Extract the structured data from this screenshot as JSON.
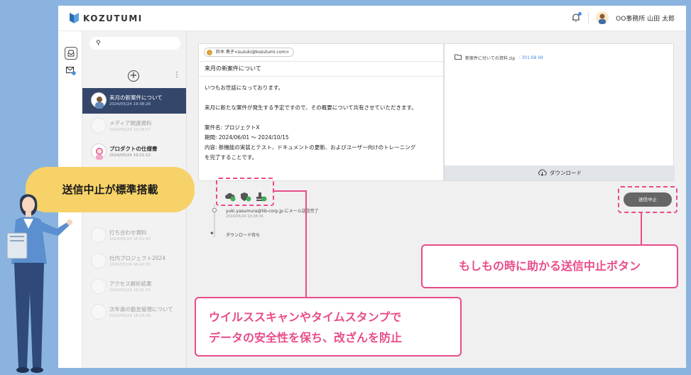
{
  "app": {
    "logo_text": "KOZUTUMI"
  },
  "header": {
    "user_name": "OO事務所 山田 太郎"
  },
  "list": {
    "items": [
      {
        "title": "来月の新案件について",
        "date": "2024/05/24 19:38:26",
        "state": "selected"
      },
      {
        "title": "メディア関連資料",
        "date": "2024/05/24 19:28:07",
        "state": "dim"
      },
      {
        "title": "プロダクトの仕様書",
        "date": "2024/05/24 19:22:12",
        "state": "normal"
      },
      {
        "title": "打ち合わせ資料",
        "date": "2024/05/24 16:52:47",
        "state": "dim"
      },
      {
        "title": "社内プロジェクト2024",
        "date": "2024/05/24 16:42:33",
        "state": "dim"
      },
      {
        "title": "アクセス解析結果",
        "date": "2024/05/24 16:31:15",
        "state": "dim"
      },
      {
        "title": "次年度の勤怠管理について",
        "date": "2024/05/24 16:29:06",
        "state": "dim"
      }
    ]
  },
  "mail": {
    "sender": "鈴木 貴子<suzuki@kozutumi.com>",
    "subject": "来月の新案件について",
    "body": [
      "いつもお世話になっております。",
      "来月に新たな案件が発生する予定ですので、その概要について共有させていただきます。",
      "案件名: プロジェクトX",
      "期間: 2024/06/01 〜 2024/10/15",
      "内容: 新機能の実装とテスト、ドキュメントの更新、およびユーザー向けのトレーニング",
      "を完了することです。"
    ]
  },
  "attachment": {
    "file_name": "新案件に付いての資料.zip",
    "file_size": "- 301.68 kB",
    "download_label": "ダウンロード"
  },
  "timeline": {
    "event1": "yuki.yasumura@hb-corp.jp にメール送信完了",
    "event1_date": "2024/05/24 19:38:34",
    "event2": "ダウンロード待ち"
  },
  "buttons": {
    "stop_label": "送信中止"
  },
  "callouts": {
    "bubble": "送信中止が標準搭載",
    "stop_note": "もしもの時に助かる送信中止ボタン",
    "security_line1": "ウイルススキャンやタイムスタンプで",
    "security_line2": "データの安全性を保ち、改ざんを防止"
  },
  "colors": {
    "accent": "#e84c8b",
    "selected_row": "#34476b",
    "bubble": "#f6d268",
    "frame": "#8ab4df"
  }
}
